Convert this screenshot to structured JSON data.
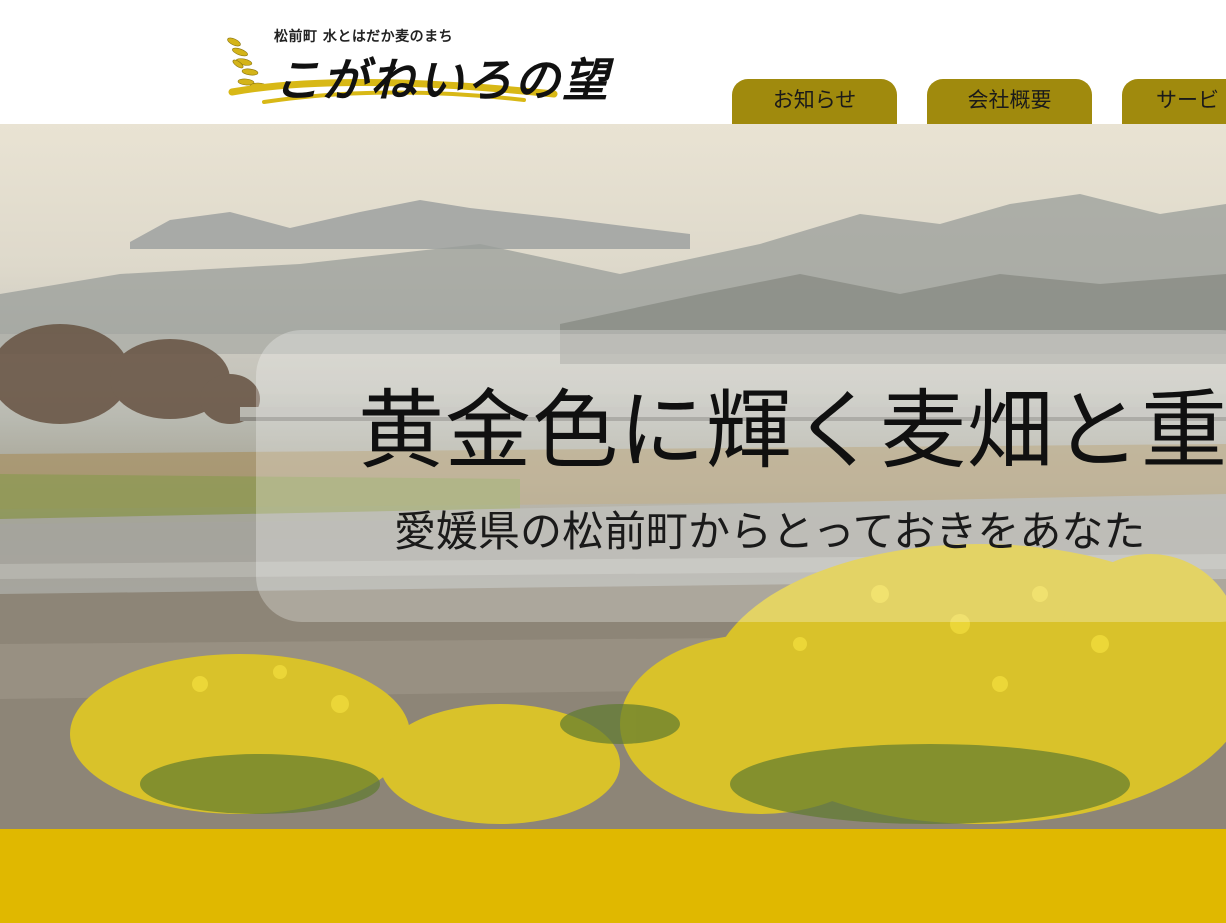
{
  "header": {
    "logo": {
      "tagline": "松前町 水とはだか麦のまち",
      "title": "こがねいろの望"
    },
    "nav": [
      {
        "label": "お知らせ"
      },
      {
        "label": "会社概要"
      },
      {
        "label": "サービ"
      }
    ],
    "nav_color": "#a08a0d"
  },
  "hero": {
    "headline": "黄金色に輝く麦畑と重信",
    "subheadline": "愛媛県の松前町からとっておきをあなた"
  },
  "footer_band": {
    "color": "#e0b800"
  }
}
